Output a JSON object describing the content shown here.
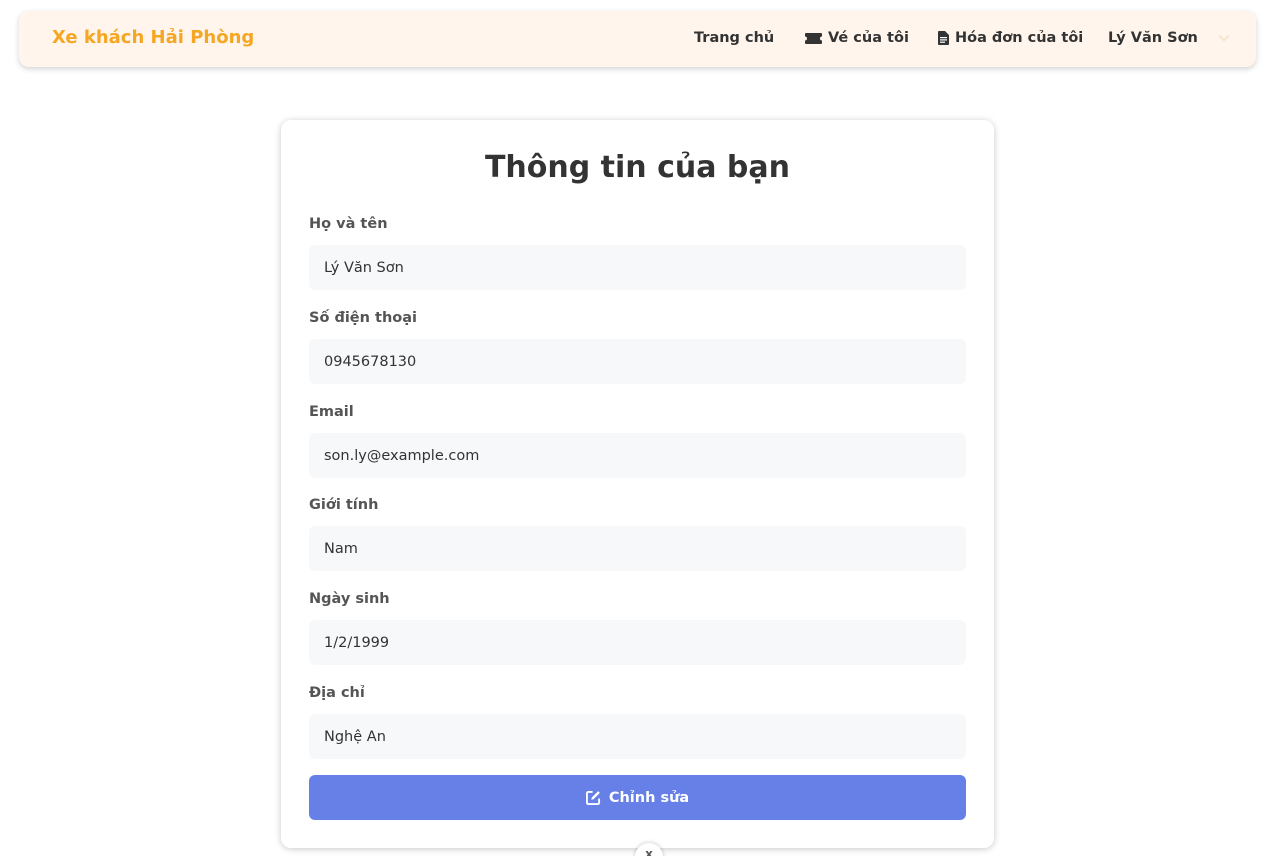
{
  "navbar": {
    "brand": "Xe khách Hải Phòng",
    "links": {
      "home": "Trang chủ",
      "tickets": "Vé của tôi",
      "invoices": "Hóa đơn của tôi"
    },
    "user_name": "Lý Văn Sơn",
    "brand_color": "#f5a623",
    "background_color": "#fff5ec"
  },
  "profile": {
    "title": "Thông tin của bạn",
    "fields": [
      {
        "label": "Họ và tên",
        "value": "Lý Văn Sơn"
      },
      {
        "label": "Số điện thoại",
        "value": "0945678130"
      },
      {
        "label": "Email",
        "value": "son.ly@example.com"
      },
      {
        "label": "Giới tính",
        "value": "Nam"
      },
      {
        "label": "Ngày sinh",
        "value": "1/2/1999"
      },
      {
        "label": "Địa chỉ",
        "value": "Nghệ An"
      }
    ],
    "edit_label": "Chỉnh sửa",
    "button_color": "#6680e8"
  },
  "icons": {
    "tickets": "ticket-icon",
    "invoices": "file-invoice-icon",
    "user_menu": "chevron-down-icon",
    "edit": "edit-icon",
    "close": "close-icon"
  },
  "close_glyph": "x"
}
